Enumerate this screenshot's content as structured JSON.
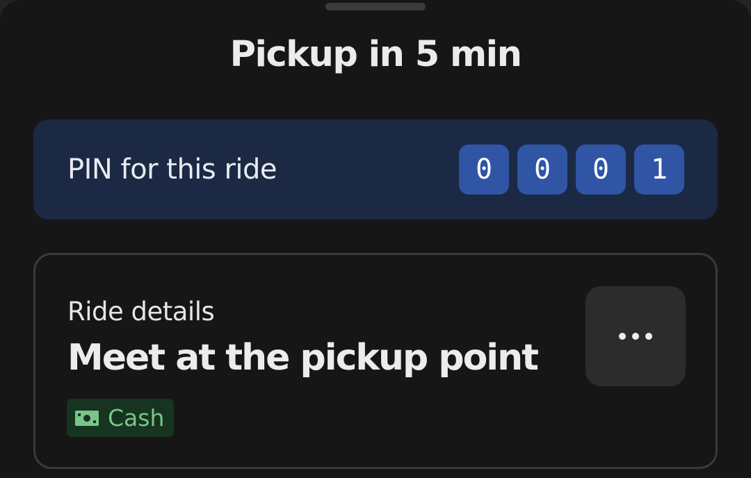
{
  "sheet": {
    "title": "Pickup in 5 min"
  },
  "pin": {
    "label": "PIN for this ride",
    "digits": [
      "0",
      "0",
      "0",
      "1"
    ]
  },
  "ride_details": {
    "label": "Ride details",
    "headline": "Meet at the pickup point",
    "more_icon": "more-horizontal-icon",
    "payment": {
      "icon": "cash-icon",
      "label": "Cash"
    }
  },
  "colors": {
    "background": "#161616",
    "pin_card": "#1b2944",
    "pin_digit": "#2f55a4",
    "cash_chip": "#16341f",
    "cash_text": "#79c58a"
  }
}
